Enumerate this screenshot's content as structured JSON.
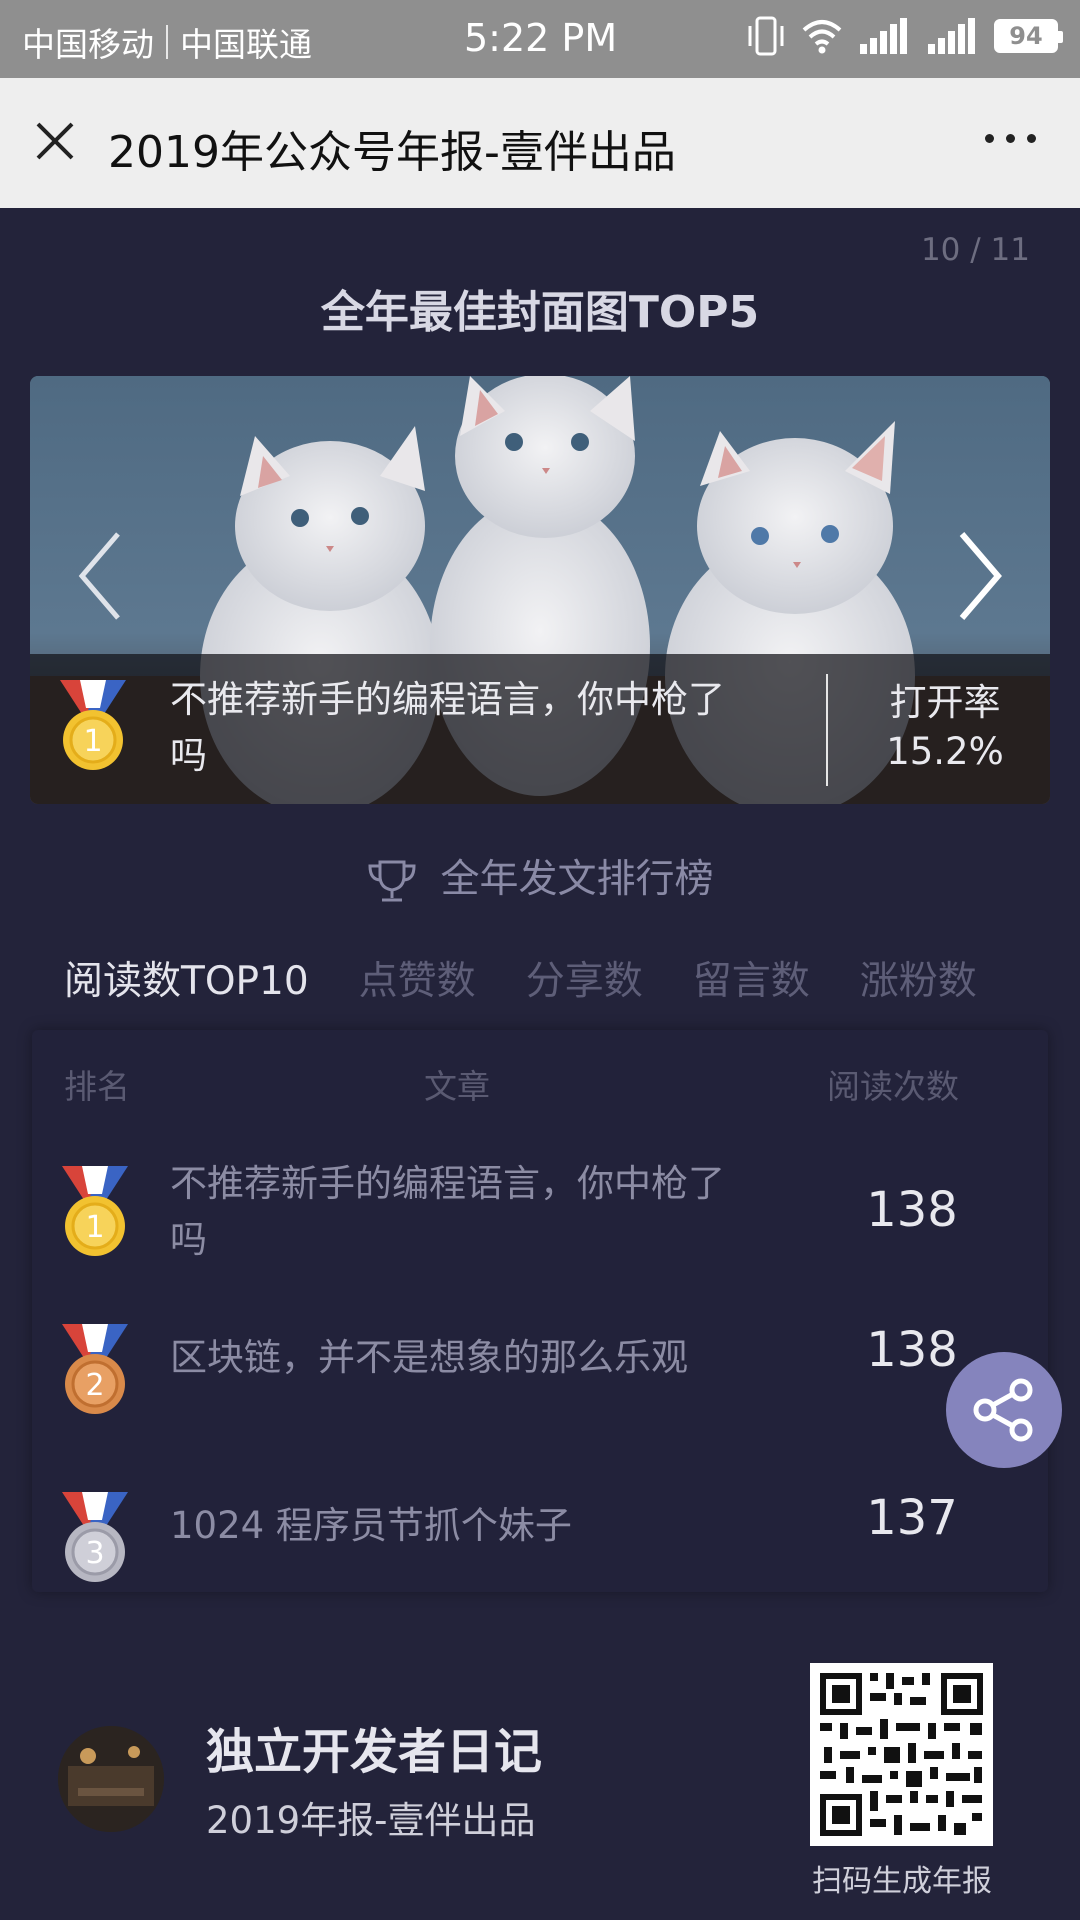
{
  "status_bar": {
    "carrier1": "中国移动",
    "carrier2": "中国联通",
    "time": "5:22 PM",
    "battery": "94"
  },
  "title_bar": {
    "title": "2019年公众号年报-壹伴出品"
  },
  "page_indicator": "10 / 11",
  "cover_section": {
    "title": "全年最佳封面图TOP5",
    "rank": 1,
    "article_title": "不推荐新手的编程语言，你中枪了吗",
    "rate_label": "打开率",
    "rate_value": "15.2%"
  },
  "ranking": {
    "title": "全年发文排行榜",
    "tabs": [
      {
        "label": "阅读数TOP10",
        "active": true
      },
      {
        "label": "点赞数",
        "active": false
      },
      {
        "label": "分享数",
        "active": false
      },
      {
        "label": "留言数",
        "active": false
      },
      {
        "label": "涨粉数",
        "active": false
      }
    ],
    "headers": {
      "rank": "排名",
      "article": "文章",
      "count": "阅读次数"
    },
    "rows": [
      {
        "rank": "1",
        "medal": "gold",
        "title": "不推荐新手的编程语言，你中枪了吗",
        "count": "138"
      },
      {
        "rank": "2",
        "medal": "bronze",
        "title": "区块链，并不是想象的那么乐观",
        "count": "138"
      },
      {
        "rank": "3",
        "medal": "silver",
        "title": "1024 程序员节抓个妹子",
        "count": "137"
      }
    ]
  },
  "footer": {
    "account_name": "独立开发者日记",
    "subtitle": "2019年报-壹伴出品",
    "qr_caption": "扫码生成年报"
  },
  "colors": {
    "background": "#23233a",
    "accent": "#8584bd",
    "gold": "#f2c230",
    "bronze": "#d98a4a",
    "silver": "#b7b7c2"
  }
}
